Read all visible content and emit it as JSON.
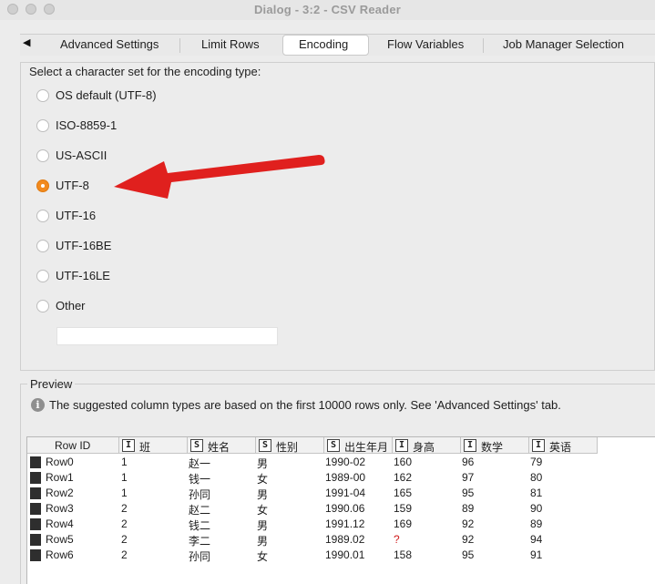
{
  "window": {
    "title": "Dialog - 3:2 - CSV Reader"
  },
  "tabs": {
    "scroll_left": "◀",
    "items": [
      "Advanced Settings",
      "Limit Rows",
      "Encoding",
      "Flow Variables",
      "Job Manager Selection"
    ],
    "active": "Encoding"
  },
  "encoding": {
    "title": "Select a character set for the encoding type:",
    "options": [
      "OS default (UTF-8)",
      "ISO-8859-1",
      "US-ASCII",
      "UTF-8",
      "UTF-16",
      "UTF-16BE",
      "UTF-16LE",
      "Other"
    ],
    "selected": "UTF-8",
    "other_value": ""
  },
  "annotation": {
    "color": "#e0201e"
  },
  "preview": {
    "title": "Preview",
    "info": "The suggested column types are based on the first 10000 rows only. See 'Advanced Settings' tab.",
    "columns": [
      {
        "type": "",
        "label": "Row ID"
      },
      {
        "type": "I",
        "label": "班"
      },
      {
        "type": "S",
        "label": "姓名"
      },
      {
        "type": "S",
        "label": "性别"
      },
      {
        "type": "S",
        "label": "出生年月"
      },
      {
        "type": "I",
        "label": "身高"
      },
      {
        "type": "I",
        "label": "数学"
      },
      {
        "type": "I",
        "label": "英语"
      }
    ],
    "rows": [
      [
        "Row0",
        "1",
        "赵一",
        "男",
        "1990-02",
        "160",
        "96",
        "79"
      ],
      [
        "Row1",
        "1",
        "钱一",
        "女",
        "1989-00",
        "162",
        "97",
        "80"
      ],
      [
        "Row2",
        "1",
        "孙同",
        "男",
        "1991-04",
        "165",
        "95",
        "81"
      ],
      [
        "Row3",
        "2",
        "赵二",
        "女",
        "1990.06",
        "159",
        "89",
        "90"
      ],
      [
        "Row4",
        "2",
        "钱二",
        "男",
        "1991.12",
        "169",
        "92",
        "89"
      ],
      [
        "Row5",
        "2",
        "李二",
        "男",
        "1989.02",
        "?",
        "92",
        "94"
      ],
      [
        "Row6",
        "2",
        "孙同",
        "女",
        "1990.01",
        "158",
        "95",
        "91"
      ]
    ]
  }
}
